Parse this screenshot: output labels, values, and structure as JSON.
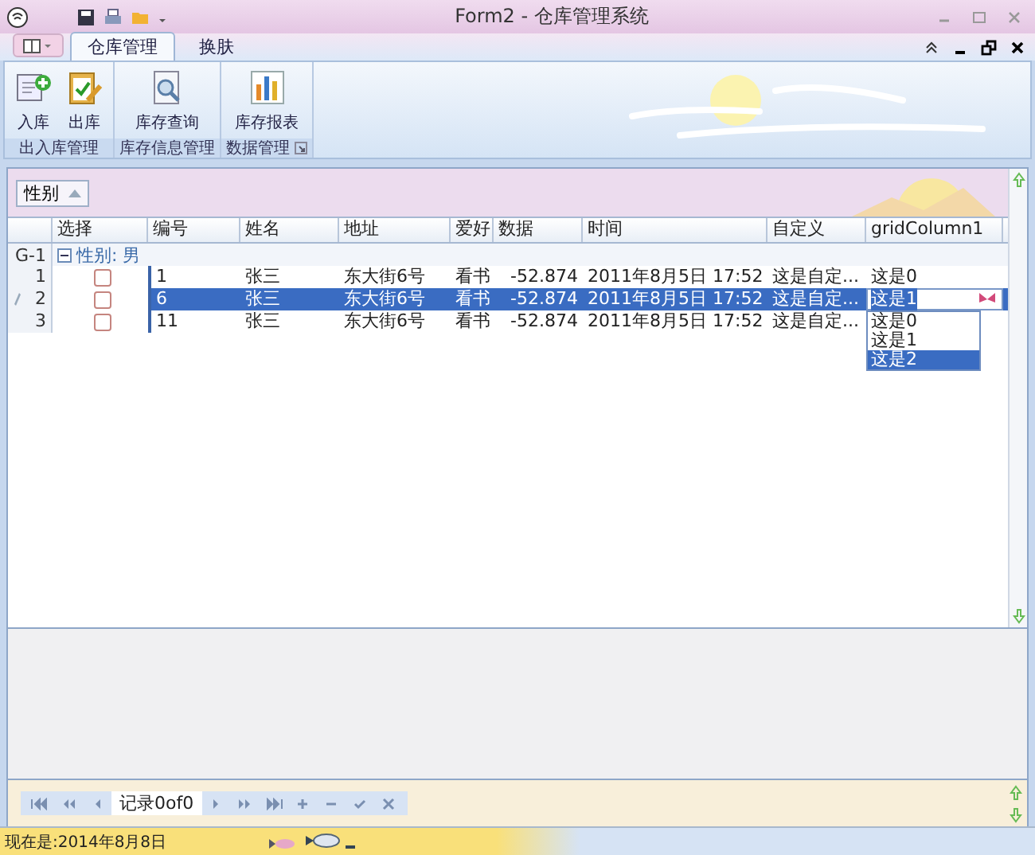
{
  "window": {
    "title": "Form2 - 仓库管理系统"
  },
  "ribbon": {
    "tabs": [
      {
        "label": "仓库管理",
        "selected": true
      },
      {
        "label": "换肤",
        "selected": false
      }
    ],
    "groups": [
      {
        "label": "出入库管理",
        "launcher": false,
        "buttons": [
          {
            "label": "入库",
            "kind": "import"
          },
          {
            "label": "出库",
            "kind": "export"
          }
        ]
      },
      {
        "label": "库存信息管理",
        "launcher": false,
        "buttons": [
          {
            "label": "库存查询",
            "kind": "query"
          }
        ]
      },
      {
        "label": "数据管理",
        "launcher": true,
        "buttons": [
          {
            "label": "库存报表",
            "kind": "report"
          }
        ]
      }
    ]
  },
  "grid": {
    "group_panel": {
      "column": "性别"
    },
    "select_column": "选择",
    "columns": [
      "编号",
      "姓名",
      "地址",
      "爱好",
      "数据",
      "时间",
      "自定义",
      "gridColumn1"
    ],
    "group_row": {
      "indicator": "G-1",
      "label": "性别: 男",
      "expanded": true
    },
    "rows": [
      {
        "indicator": "1",
        "selected": false,
        "editing": false,
        "checked": false,
        "cells": [
          "1",
          "张三",
          "东大街6号",
          "看书",
          "-52.874",
          "2011年8月5日 17:52",
          "这是自定...",
          "这是0"
        ]
      },
      {
        "indicator": "2",
        "selected": true,
        "editing": true,
        "checked": false,
        "cells": [
          "6",
          "张三",
          "东大街6号",
          "看书",
          "-52.874",
          "2011年8月5日 17:52",
          "这是自定...",
          "这是1"
        ]
      },
      {
        "indicator": "3",
        "selected": false,
        "editing": false,
        "checked": false,
        "cells": [
          "11",
          "张三",
          "东大街6号",
          "看书",
          "-52.874",
          "2011年8月5日 17:52",
          "这是自定..."
        ]
      }
    ],
    "dropdown": {
      "options": [
        {
          "label": "这是0",
          "selected": false
        },
        {
          "label": "这是1",
          "selected": false
        },
        {
          "label": "这是2",
          "selected": true
        }
      ]
    }
  },
  "navigator": {
    "record_text": "记录0of0"
  },
  "status_bar": {
    "text": "现在是:2014年8月8日"
  }
}
